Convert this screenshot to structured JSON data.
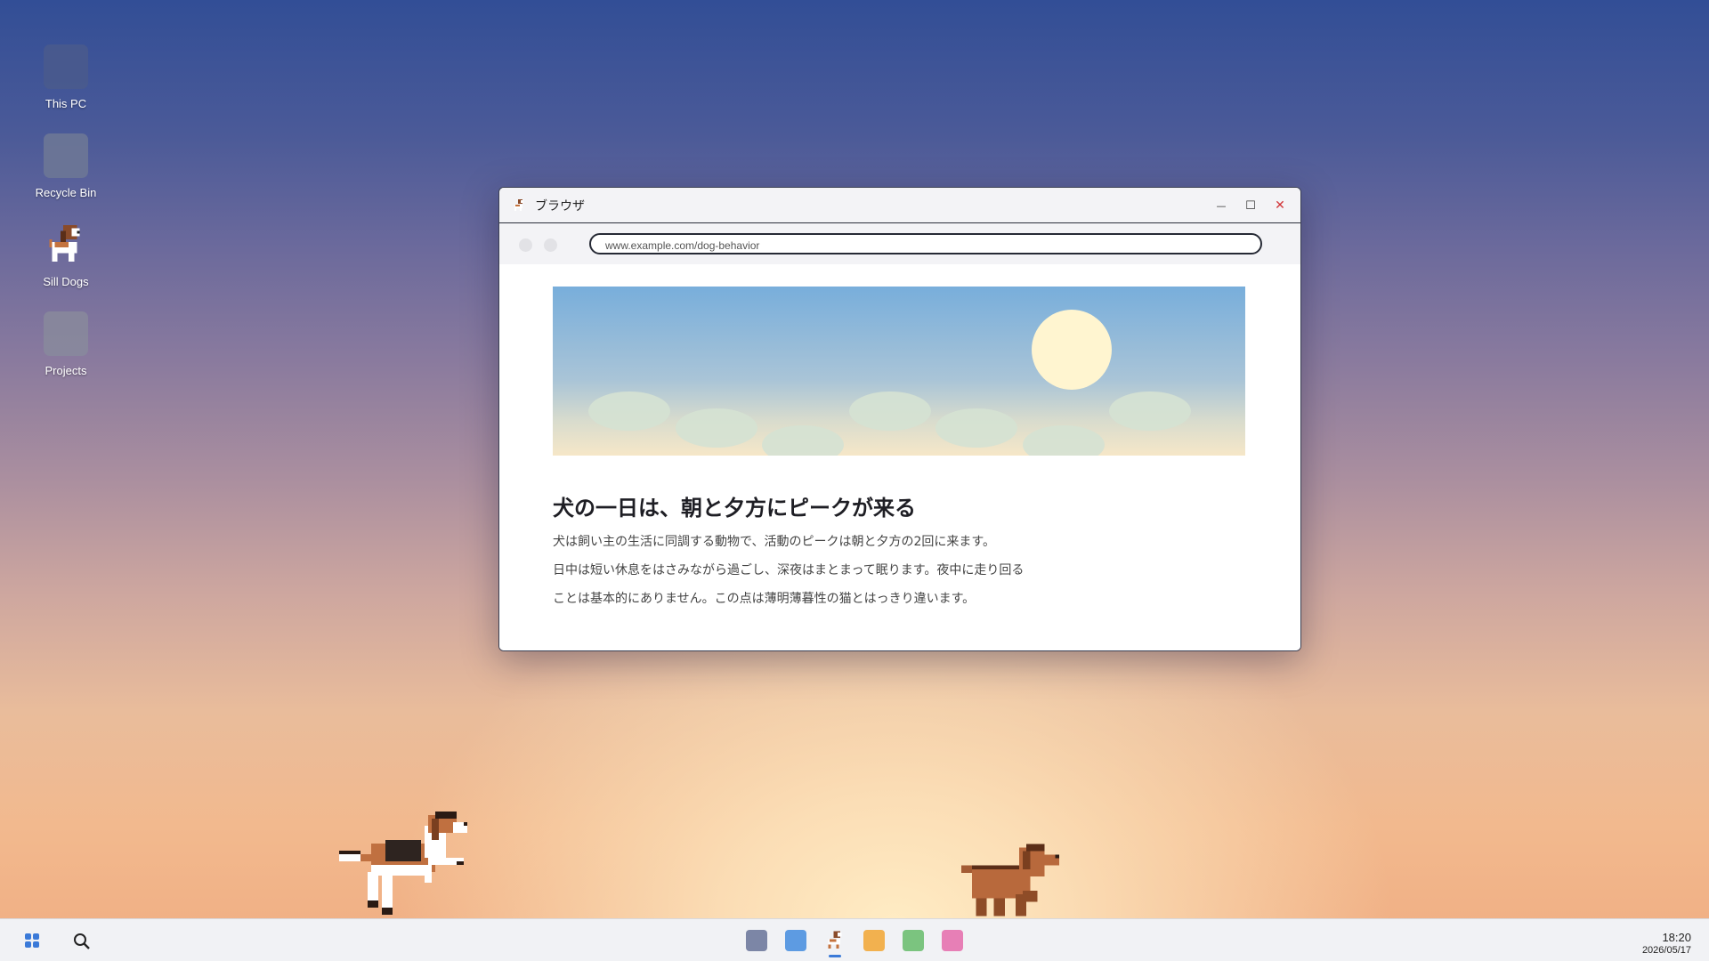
{
  "desktop": {
    "icons": [
      {
        "label": "This PC",
        "color": "#4a5a8c"
      },
      {
        "label": "Recycle Bin",
        "color": "#6d7796"
      },
      {
        "label": "Sill Dogs",
        "icon": "beagle-dog-icon"
      },
      {
        "label": "Projects",
        "color": "#888a9c"
      }
    ]
  },
  "window": {
    "title": "ブラウザ",
    "controls": {
      "minimize": "—",
      "maximize": "☐",
      "close": "✕"
    },
    "url": "www.example.com/dog-behavior",
    "article": {
      "headline": "犬の一日は、朝と夕方にピークが来る",
      "lines": [
        "犬は飼い主の生活に同調する動物で、活動のピークは朝と夕方の2回に来ます。",
        "日中は短い休息をはさみながら過ごし、深夜はまとまって眠ります。夜中に走り回る",
        "ことは基本的にありません。この点は薄明薄暮性の猫とはっきり違います。"
      ]
    }
  },
  "taskbar": {
    "apps": [
      {
        "name": "gray-app",
        "color": "#7c86a6"
      },
      {
        "name": "blue-app",
        "color": "#5d9be2"
      },
      {
        "name": "sill-dogs-app",
        "icon": "beagle-dog-icon",
        "active": true
      },
      {
        "name": "orange-app",
        "color": "#f2b14f"
      },
      {
        "name": "green-app",
        "color": "#7bc47f"
      },
      {
        "name": "pink-app",
        "color": "#e77fb6"
      }
    ],
    "time": "18:20",
    "date": "2026/05/17"
  },
  "colors": {
    "close_red": "#d13438",
    "accent_blue": "#3b7ad8"
  }
}
